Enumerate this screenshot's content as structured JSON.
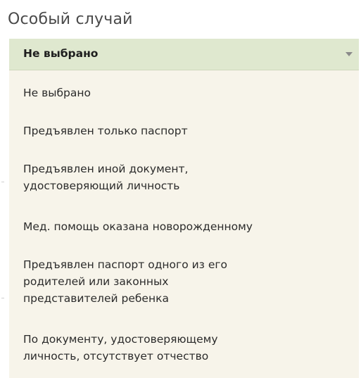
{
  "field": {
    "label": "Особый случай",
    "selected_value": "Не выбрано"
  },
  "options": [
    {
      "lines": [
        "Не выбрано"
      ]
    },
    {
      "lines": [
        "Предъявлен только паспорт"
      ]
    },
    {
      "lines": [
        "Предъявлен иной документ,",
        "удостоверяющий личность"
      ]
    },
    {
      "lines": [
        "Мед. помощь оказана новорожденному"
      ]
    },
    {
      "lines": [
        "Предъявлен паспорт одного из его",
        "родителей или законных",
        "представителей ребенка"
      ]
    },
    {
      "lines": [
        "По документу, удостоверяющему",
        "личность, отсутствует отчество"
      ]
    }
  ],
  "icons": {
    "dropdown_arrow": "chevron-down-icon"
  },
  "colors": {
    "select_background": "#dfe8cf",
    "dropdown_background": "#f7f4ea",
    "label_text": "#4a4a4a"
  }
}
